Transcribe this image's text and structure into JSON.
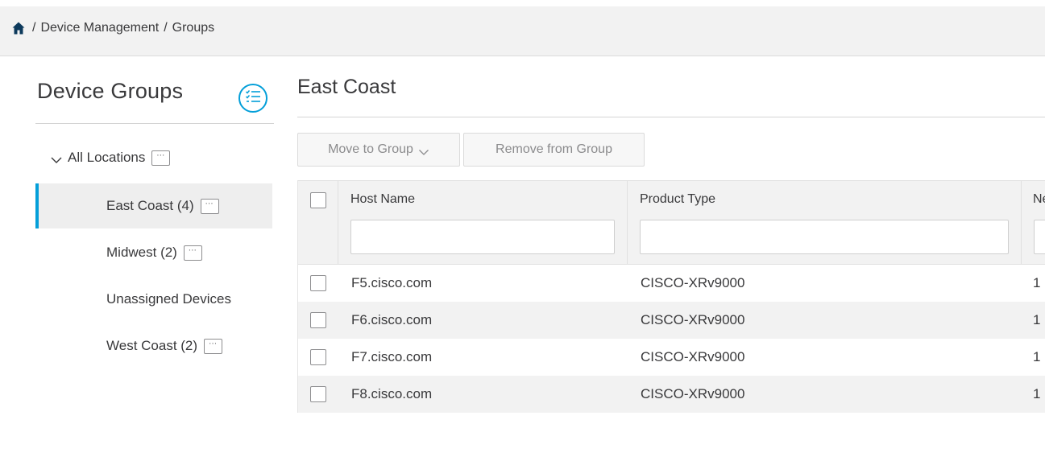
{
  "breadcrumb": {
    "home_icon": "home-icon",
    "separator": "/",
    "items": [
      "Device Management",
      "Groups"
    ]
  },
  "sidebar": {
    "title": "Device Groups",
    "menu_icon": "list-settings-icon",
    "root": {
      "label": "All Locations",
      "more": "⋯"
    },
    "items": [
      {
        "label": "East Coast (4)",
        "selected": true,
        "has_more": true,
        "more": "⋯"
      },
      {
        "label": "Midwest (2)",
        "selected": false,
        "has_more": true,
        "more": "⋯"
      },
      {
        "label": "Unassigned Devices",
        "selected": false,
        "has_more": false
      },
      {
        "label": "West Coast (2)",
        "selected": false,
        "has_more": true,
        "more": "⋯"
      }
    ]
  },
  "main": {
    "title": "East Coast",
    "toolbar": {
      "move_label": "Move to Group",
      "remove_label": "Remove from Group"
    },
    "table": {
      "columns": [
        "Host Name",
        "Product Type",
        "Ne"
      ],
      "rows": [
        {
          "host": "F5.cisco.com",
          "product": "CISCO-XRv9000",
          "ne": "1"
        },
        {
          "host": "F6.cisco.com",
          "product": "CISCO-XRv9000",
          "ne": "1"
        },
        {
          "host": "F7.cisco.com",
          "product": "CISCO-XRv9000",
          "ne": "1"
        },
        {
          "host": "F8.cisco.com",
          "product": "CISCO-XRv9000",
          "ne": "1"
        }
      ]
    }
  },
  "colors": {
    "accent": "#049fd9",
    "text": "#39393b",
    "header_bg": "#f2f2f2"
  }
}
